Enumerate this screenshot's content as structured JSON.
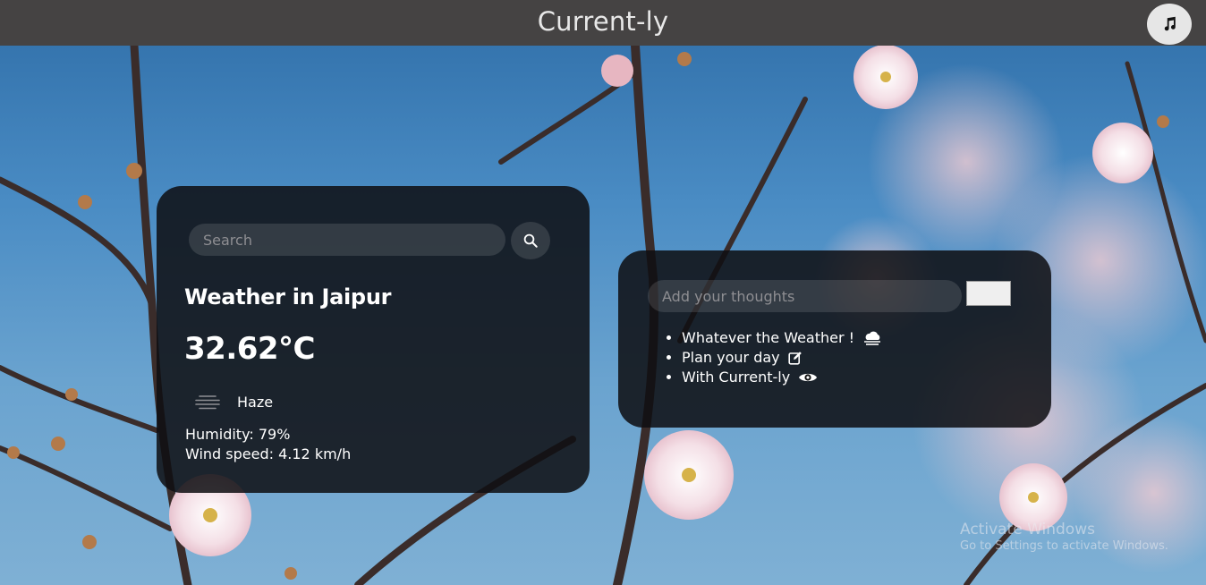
{
  "app": {
    "title": "Current-ly",
    "music_icon": "music-note-icon"
  },
  "weather": {
    "search_placeholder": "Search",
    "search_icon": "search-icon",
    "city_heading": "Weather in Jaipur",
    "temperature": "32.62°C",
    "condition_icon": "haze-icon",
    "condition": "Haze",
    "humidity": "Humidity: 79%",
    "wind": "Wind speed: 4.12 km/h"
  },
  "thoughts": {
    "input_placeholder": "Add your thoughts",
    "add_button_label": "",
    "items": [
      {
        "text": "Whatever the Weather !",
        "icon": "cloud-sun-icon"
      },
      {
        "text": "Plan your day",
        "icon": "edit-icon"
      },
      {
        "text": "With Current-ly",
        "icon": "eye-icon"
      }
    ]
  },
  "watermark": {
    "title": "Activate Windows",
    "subtitle": "Go to Settings to activate Windows."
  },
  "colors": {
    "topbar": "#454343",
    "card": "#0e0e12",
    "text": "#ffffff",
    "placeholder": "#8e8e92"
  }
}
